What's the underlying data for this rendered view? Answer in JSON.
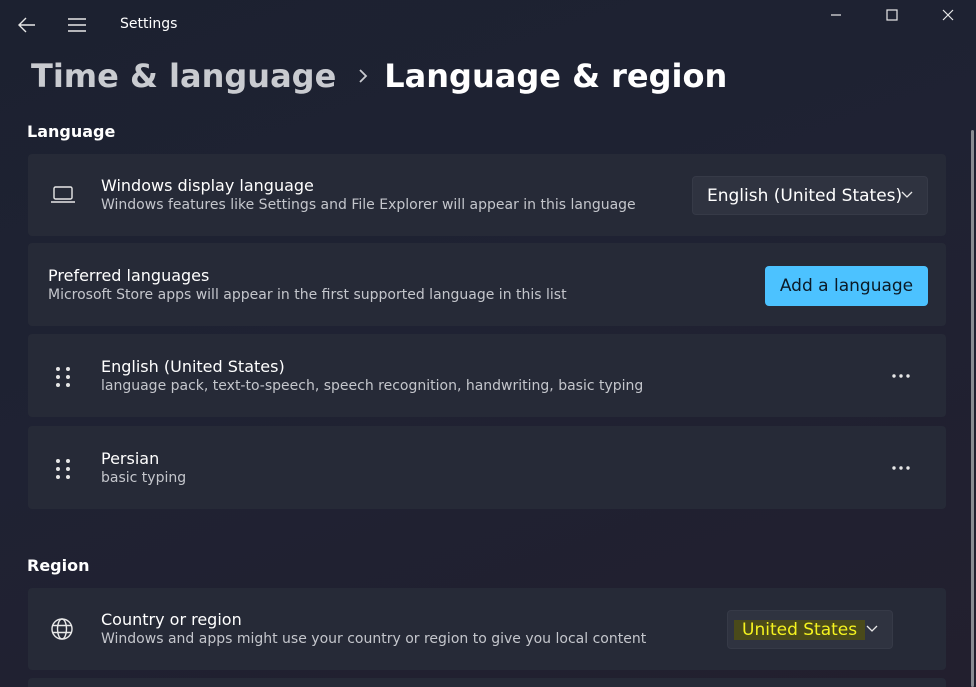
{
  "titlebar": {
    "app_title": "Settings",
    "icons": {
      "back": "back-arrow-icon",
      "menu": "hamburger-menu-icon"
    },
    "window_controls": [
      "minimize-icon",
      "maximize-icon",
      "close-icon"
    ]
  },
  "breadcrumb": {
    "parent": "Time & language",
    "separator_icon": "chevron-right-icon",
    "current": "Language & region"
  },
  "language_section": {
    "title": "Language",
    "display_language": {
      "icon": "laptop-icon",
      "title": "Windows display language",
      "subtitle": "Windows features like Settings and File Explorer will appear in this language",
      "selected": "English (United States)"
    },
    "preferred": {
      "title": "Preferred languages",
      "subtitle": "Microsoft Store apps will appear in the first supported language in this list",
      "button_label": "Add a language"
    },
    "languages": [
      {
        "name": "English (United States)",
        "features": "language pack, text-to-speech, speech recognition, handwriting, basic typing"
      },
      {
        "name": "Persian",
        "features": "basic typing"
      }
    ]
  },
  "region_section": {
    "title": "Region",
    "country": {
      "icon": "globe-icon",
      "title": "Country or region",
      "subtitle": "Windows and apps might use your country or region to give you local content",
      "selected": "United States"
    }
  },
  "colors": {
    "accent": "#4cc2ff",
    "card": "#262a37",
    "highlight_text": "#f5f31f",
    "highlight_bg": "#4a4a1a"
  }
}
